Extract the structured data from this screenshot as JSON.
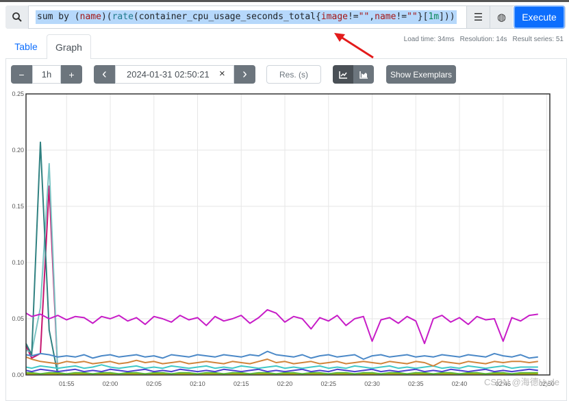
{
  "query": {
    "parts": [
      {
        "t": "sum by (",
        "c": ""
      },
      {
        "t": "name",
        "c": "k-lbl"
      },
      {
        "t": ")(",
        "c": ""
      },
      {
        "t": "rate",
        "c": "k-fn"
      },
      {
        "t": "(container_cpu_usage_seconds_total{",
        "c": ""
      },
      {
        "t": "image",
        "c": "k-lbl"
      },
      {
        "t": "!=",
        "c": ""
      },
      {
        "t": "\"\"",
        "c": "k-str"
      },
      {
        "t": ",",
        "c": ""
      },
      {
        "t": "name",
        "c": "k-lbl"
      },
      {
        "t": "!=",
        "c": ""
      },
      {
        "t": "\"\"",
        "c": "k-str"
      },
      {
        "t": "}[",
        "c": ""
      },
      {
        "t": "1m",
        "c": "k-dur"
      },
      {
        "t": "]))",
        "c": ""
      }
    ],
    "execute_label": "Execute"
  },
  "stats": {
    "load_time": "Load time: 34ms",
    "resolution": "Resolution: 14s",
    "result_series": "Result series: 51"
  },
  "tabs": [
    {
      "label": "Table",
      "active": false
    },
    {
      "label": "Graph",
      "active": true
    }
  ],
  "controls": {
    "range": "1h",
    "end_time": "2024-01-31 02:50:21",
    "res_placeholder": "Res. (s)",
    "show_exemplars": "Show Exemplars",
    "clear": "×",
    "minus": "−",
    "plus": "+",
    "prev": "‹",
    "next": "›"
  },
  "watermark": "CSDN @海德Hyde",
  "chart_data": {
    "type": "line",
    "ylim": [
      0,
      0.25
    ],
    "yticks": [
      "0.00",
      "0.05",
      "0.10",
      "0.15",
      "0.20",
      "0.25"
    ],
    "xticks": [
      "01:55",
      "02:00",
      "02:05",
      "02:10",
      "02:15",
      "02:20",
      "02:25",
      "02:30",
      "02:35",
      "02:40",
      "02:45",
      "02:50"
    ],
    "xlim": [
      "01:50:21",
      "02:50:21"
    ],
    "grid": true,
    "x": [
      "01:51",
      "01:52",
      "01:53",
      "01:54",
      "01:55",
      "01:56",
      "01:57",
      "01:58",
      "01:59",
      "02:00",
      "02:01",
      "02:02",
      "02:03",
      "02:04",
      "02:05",
      "02:06",
      "02:07",
      "02:08",
      "02:09",
      "02:10",
      "02:11",
      "02:12",
      "02:13",
      "02:14",
      "02:15",
      "02:16",
      "02:17",
      "02:18",
      "02:19",
      "02:20",
      "02:21",
      "02:22",
      "02:23",
      "02:24",
      "02:25",
      "02:26",
      "02:27",
      "02:28",
      "02:29",
      "02:30",
      "02:31",
      "02:32",
      "02:33",
      "02:34",
      "02:35",
      "02:36",
      "02:37",
      "02:38",
      "02:39",
      "02:40",
      "02:41",
      "02:42",
      "02:43",
      "02:44",
      "02:45",
      "02:46",
      "02:47",
      "02:48",
      "02:49",
      "02:50"
    ],
    "series": [
      {
        "color": "#c71bc7",
        "values": [
          0.055,
          0.052,
          0.054,
          0.05,
          0.053,
          0.049,
          0.052,
          0.051,
          0.046,
          0.052,
          0.05,
          0.053,
          0.048,
          0.051,
          0.045,
          0.052,
          0.05,
          0.047,
          0.053,
          0.049,
          0.051,
          0.044,
          0.052,
          0.048,
          0.05,
          0.053,
          0.046,
          0.051,
          0.058,
          0.055,
          0.047,
          0.052,
          0.05,
          0.041,
          0.051,
          0.048,
          0.053,
          0.044,
          0.05,
          0.052,
          0.03,
          0.049,
          0.051,
          0.046,
          0.052,
          0.048,
          0.028,
          0.05,
          0.053,
          0.047,
          0.051,
          0.045,
          0.052,
          0.049,
          0.05,
          0.03,
          0.051,
          0.048,
          0.053,
          0.054
        ]
      },
      {
        "color": "#4a88c7",
        "values": [
          0.018,
          0.017,
          0.019,
          0.018,
          0.016,
          0.017,
          0.016,
          0.018,
          0.015,
          0.017,
          0.018,
          0.016,
          0.017,
          0.018,
          0.016,
          0.017,
          0.015,
          0.018,
          0.017,
          0.016,
          0.018,
          0.017,
          0.016,
          0.018,
          0.017,
          0.016,
          0.018,
          0.017,
          0.021,
          0.018,
          0.017,
          0.016,
          0.018,
          0.015,
          0.017,
          0.018,
          0.016,
          0.017,
          0.018,
          0.014,
          0.017,
          0.018,
          0.016,
          0.017,
          0.018,
          0.016,
          0.017,
          0.016,
          0.018,
          0.017,
          0.016,
          0.018,
          0.017,
          0.016,
          0.019,
          0.017,
          0.016,
          0.018,
          0.015,
          0.016
        ]
      },
      {
        "color": "#d0843a",
        "values": [
          0.016,
          0.014,
          0.012,
          0.011,
          0.01,
          0.012,
          0.011,
          0.012,
          0.01,
          0.011,
          0.012,
          0.01,
          0.011,
          0.013,
          0.011,
          0.012,
          0.01,
          0.011,
          0.012,
          0.01,
          0.011,
          0.012,
          0.011,
          0.01,
          0.012,
          0.011,
          0.01,
          0.012,
          0.014,
          0.011,
          0.012,
          0.01,
          0.011,
          0.012,
          0.01,
          0.011,
          0.012,
          0.01,
          0.011,
          0.012,
          0.011,
          0.01,
          0.012,
          0.011,
          0.01,
          0.012,
          0.011,
          0.008,
          0.012,
          0.011,
          0.01,
          0.012,
          0.011,
          0.01,
          0.012,
          0.011,
          0.012,
          0.012,
          0.011,
          0.012
        ]
      },
      {
        "color": "#3ec7c7",
        "values": [
          0.007,
          0.006,
          0.008,
          0.007,
          0.006,
          0.007,
          0.008,
          0.006,
          0.007,
          0.009,
          0.007,
          0.006,
          0.007,
          0.008,
          0.006,
          0.007,
          0.006,
          0.008,
          0.007,
          0.006,
          0.007,
          0.008,
          0.006,
          0.007,
          0.006,
          0.008,
          0.007,
          0.006,
          0.007,
          0.008,
          0.006,
          0.007,
          0.006,
          0.007,
          0.008,
          0.006,
          0.007,
          0.006,
          0.008,
          0.007,
          0.006,
          0.007,
          0.008,
          0.006,
          0.007,
          0.006,
          0.007,
          0.008,
          0.006,
          0.007,
          0.006,
          0.008,
          0.007,
          0.006,
          0.007,
          0.008,
          0.006,
          0.007,
          0.007,
          0.007
        ]
      },
      {
        "color": "#4c3fd0",
        "values": [
          0.004,
          0.003,
          0.005,
          0.004,
          0.003,
          0.004,
          0.005,
          0.003,
          0.004,
          0.003,
          0.005,
          0.004,
          0.003,
          0.004,
          0.005,
          0.003,
          0.004,
          0.003,
          0.005,
          0.004,
          0.003,
          0.004,
          0.003,
          0.005,
          0.004,
          0.003,
          0.004,
          0.005,
          0.003,
          0.004,
          0.003,
          0.004,
          0.005,
          0.003,
          0.004,
          0.003,
          0.005,
          0.004,
          0.003,
          0.004,
          0.005,
          0.003,
          0.004,
          0.003,
          0.004,
          0.005,
          0.003,
          0.004,
          0.003,
          0.005,
          0.004,
          0.003,
          0.004,
          0.005,
          0.003,
          0.004,
          0.003,
          0.004,
          0.005,
          0.004
        ]
      },
      {
        "color": "#5cb83a",
        "values": [
          0.002,
          0.002,
          0.001,
          0.002,
          0.002,
          0.001,
          0.002,
          0.002,
          0.001,
          0.002,
          0.002,
          0.001,
          0.002,
          0.002,
          0.001,
          0.002,
          0.002,
          0.001,
          0.002,
          0.002,
          0.001,
          0.002,
          0.002,
          0.001,
          0.002,
          0.002,
          0.001,
          0.002,
          0.002,
          0.001,
          0.002,
          0.002,
          0.001,
          0.002,
          0.002,
          0.001,
          0.002,
          0.002,
          0.001,
          0.002,
          0.002,
          0.001,
          0.002,
          0.002,
          0.001,
          0.002,
          0.002,
          0.001,
          0.002,
          0.002,
          0.001,
          0.002,
          0.002,
          0.001,
          0.002,
          0.002,
          0.001,
          0.002,
          0.002,
          0.002
        ]
      },
      {
        "color": "#b5a800",
        "values": [
          0.001,
          0.001,
          0.001,
          0.001,
          0.001,
          0.001,
          0.001,
          0.001,
          0.001,
          0.001,
          0.001,
          0.001,
          0.001,
          0.001,
          0.001,
          0.001,
          0.001,
          0.001,
          0.001,
          0.001,
          0.001,
          0.001,
          0.001,
          0.001,
          0.001,
          0.001,
          0.001,
          0.001,
          0.001,
          0.001,
          0.001,
          0.001,
          0.001,
          0.001,
          0.001,
          0.001,
          0.001,
          0.001,
          0.001,
          0.001,
          0.001,
          0.001,
          0.001,
          0.001,
          0.001,
          0.001,
          0.001,
          0.001,
          0.001,
          0.001,
          0.001,
          0.001,
          0.001,
          0.001,
          0.001,
          0.001,
          0.001,
          0.001,
          0.001,
          0.001
        ]
      },
      {
        "color": "#2f8080",
        "values": [
          0.028,
          0.018,
          0.207,
          0.04,
          0.0
        ]
      },
      {
        "color": "#7cc4c4",
        "values": [
          0.022,
          0.02,
          0.06,
          0.188,
          0.0
        ]
      },
      {
        "color": "#c4136e",
        "values": [
          0.026,
          0.015,
          0.019,
          0.168,
          0.0
        ]
      }
    ]
  }
}
